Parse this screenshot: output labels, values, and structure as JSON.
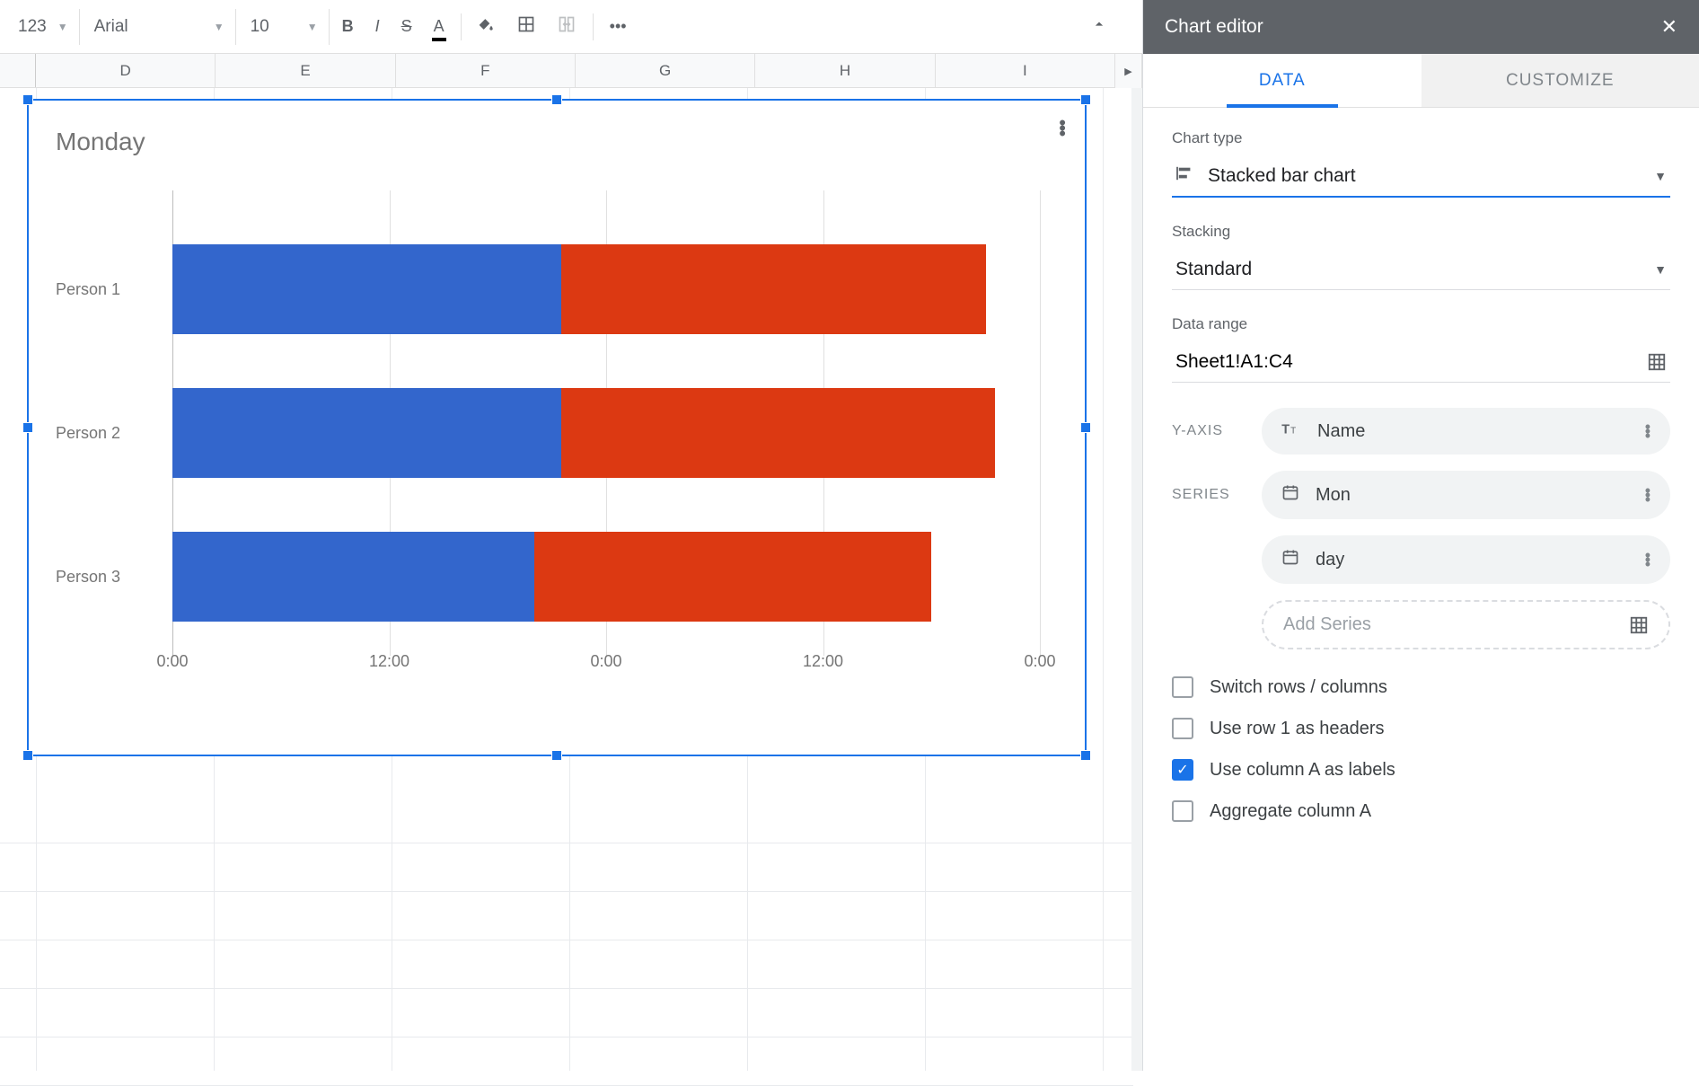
{
  "toolbar": {
    "number_format": "123",
    "font": "Arial",
    "font_size": "10",
    "bold": "B",
    "italic": "I",
    "strike": "S",
    "more": "•••"
  },
  "columns": [
    "D",
    "E",
    "F",
    "G",
    "H",
    "I"
  ],
  "chart": {
    "title": "Monday",
    "x_ticks": [
      "0:00",
      "12:00",
      "0:00",
      "12:00",
      "0:00"
    ]
  },
  "chart_data": {
    "type": "bar",
    "orientation": "horizontal",
    "stacking": "standard",
    "title": "Monday",
    "xlabel": "",
    "ylabel": "",
    "x_ticks": [
      "0:00",
      "12:00",
      "0:00",
      "12:00",
      "0:00"
    ],
    "xlim_hours": [
      0,
      48
    ],
    "categories": [
      "Person 1",
      "Person 2",
      "Person 3"
    ],
    "series": [
      {
        "name": "Mon",
        "color": "#3366cc",
        "values_hours": [
          21.5,
          21.5,
          20.0
        ]
      },
      {
        "name": "day",
        "color": "#dc3912",
        "values_hours": [
          23.5,
          24.0,
          22.0
        ]
      }
    ]
  },
  "sidebar": {
    "title": "Chart editor",
    "tabs": {
      "data": "DATA",
      "customize": "CUSTOMIZE"
    },
    "chart_type_label": "Chart type",
    "chart_type_value": "Stacked bar chart",
    "stacking_label": "Stacking",
    "stacking_value": "Standard",
    "data_range_label": "Data range",
    "data_range_value": "Sheet1!A1:C4",
    "yaxis_label": "Y-AXIS",
    "yaxis_value": "Name",
    "series_label": "SERIES",
    "series": [
      "Mon",
      "day"
    ],
    "add_series": "Add Series",
    "checks": {
      "switch": "Switch rows / columns",
      "row1": "Use row 1 as headers",
      "colA": "Use column A as labels",
      "aggregate": "Aggregate column A"
    }
  }
}
